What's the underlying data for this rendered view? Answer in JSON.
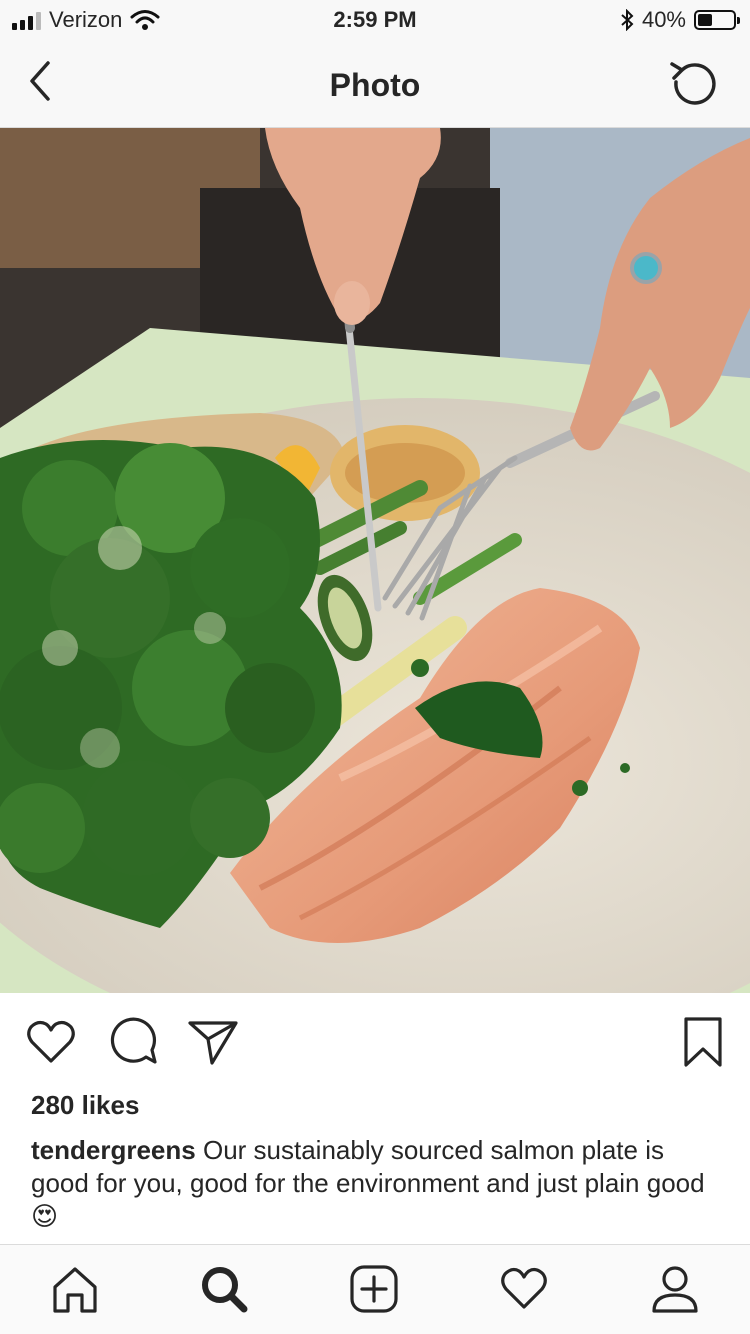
{
  "status": {
    "carrier": "Verizon",
    "time": "2:59 PM",
    "battery": "40%",
    "battery_level": 0.4
  },
  "header": {
    "title": "Photo",
    "back_icon": "chevron-left-icon",
    "refresh_icon": "refresh-icon"
  },
  "post": {
    "image_icon": "photo-image",
    "likes": "280 likes",
    "username": "tendergreens",
    "caption": "Our sustainably sourced salmon plate is good for you, good for the environment and just plain good",
    "emoji": "😍",
    "actions": [
      "heart-icon",
      "comment-icon",
      "share-icon",
      "bookmark-icon"
    ]
  },
  "tabbar": {
    "items": [
      "home-icon",
      "search-icon",
      "add-icon",
      "activity-heart-icon",
      "profile-icon"
    ]
  },
  "colors": {
    "text": "#262626",
    "bar_bg": "#f8f8f8",
    "divider": "#dbdbdb"
  }
}
